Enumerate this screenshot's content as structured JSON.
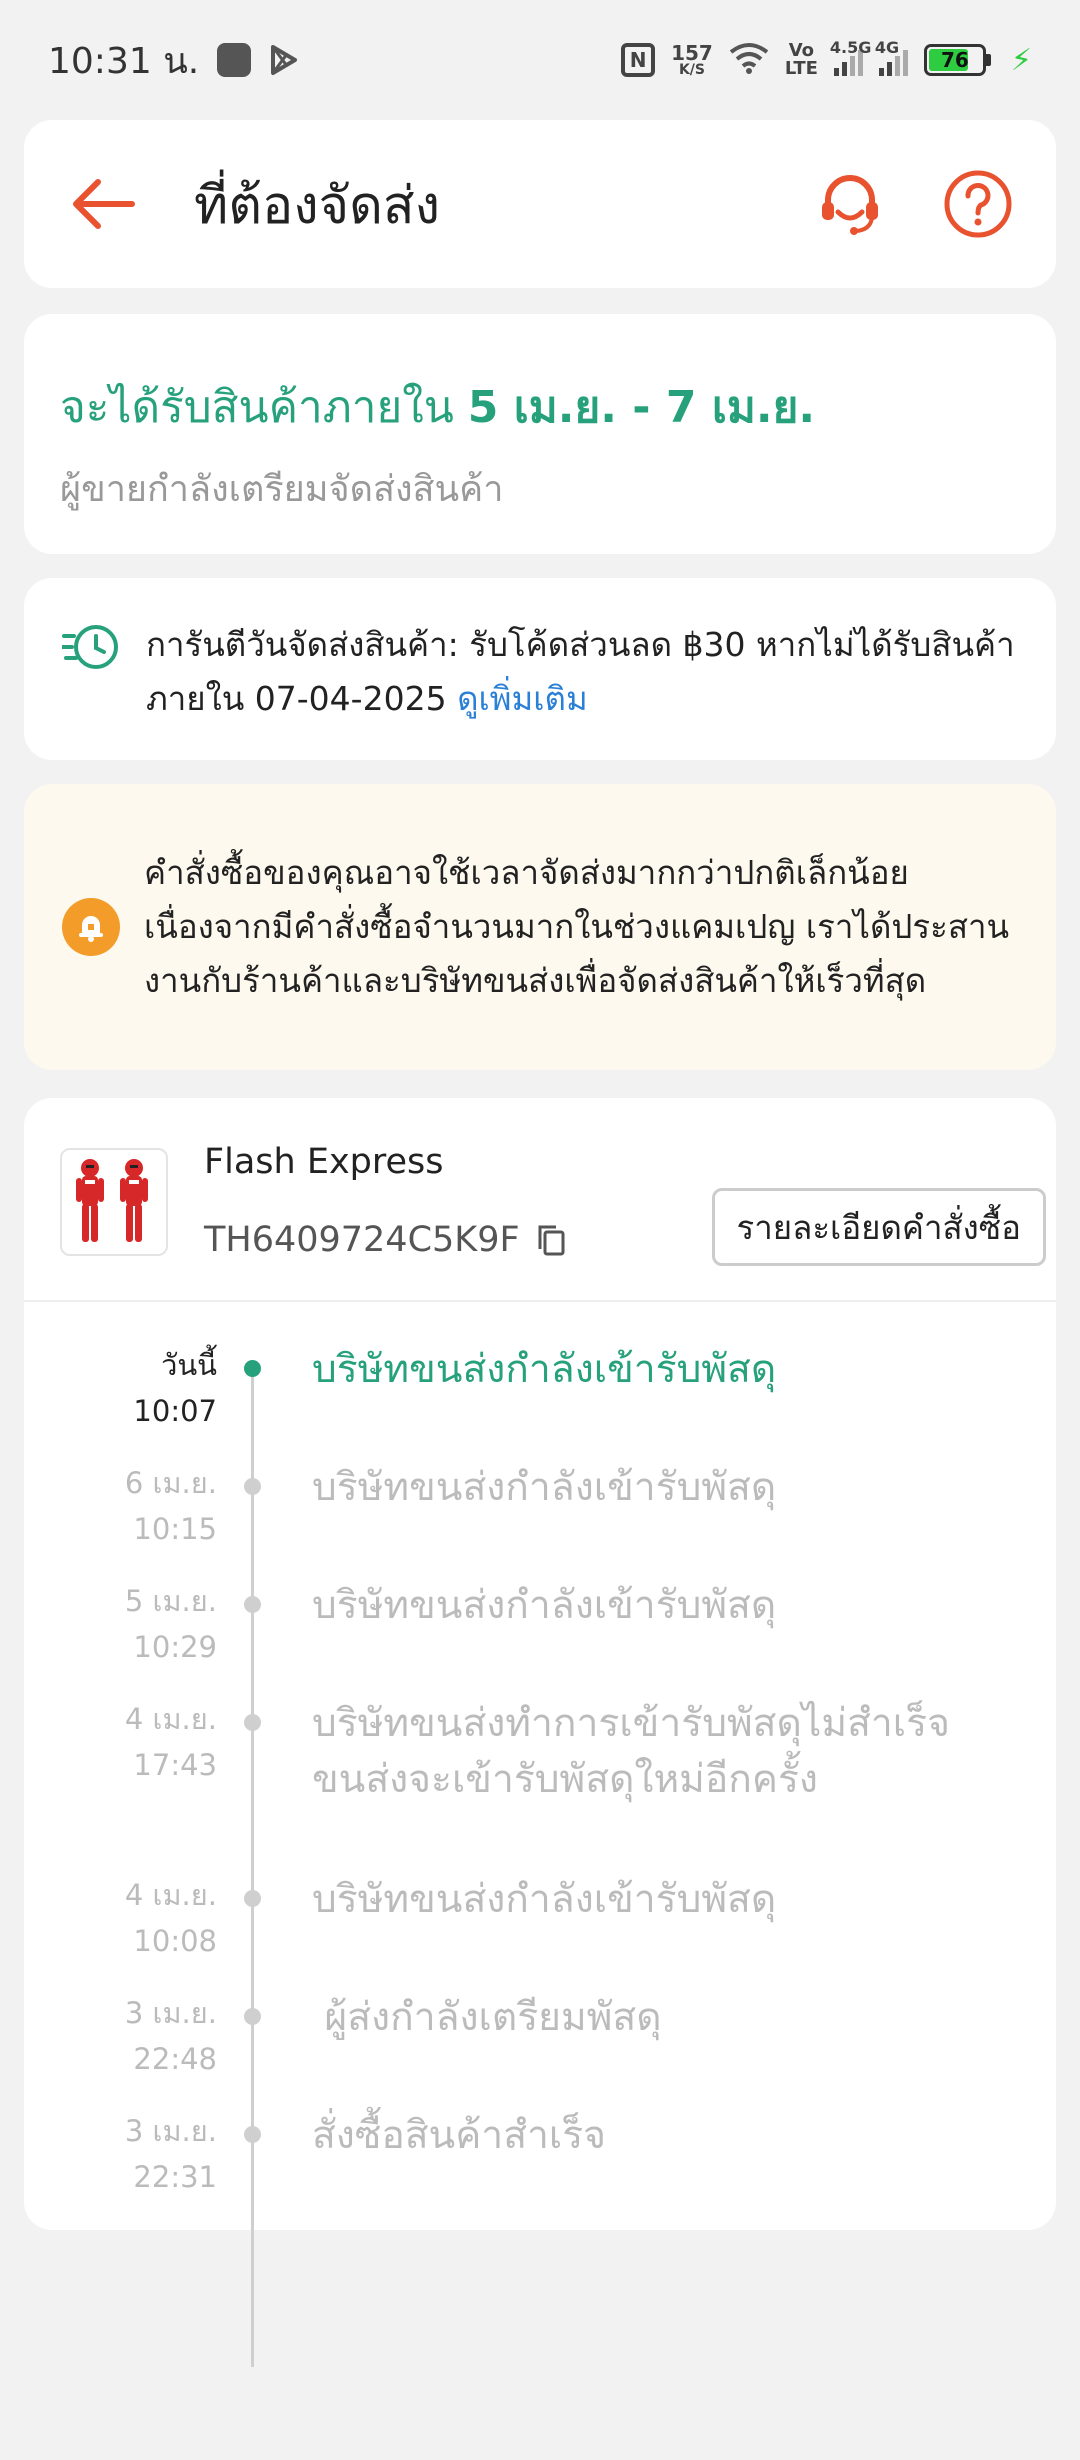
{
  "status_bar": {
    "time": "10:31 น.",
    "net_speed": "157",
    "net_unit": "K/S",
    "volte_top": "Vo",
    "volte_bottom": "LTE",
    "sig1_label": "4.5G",
    "sig2_label": "4G",
    "battery": "76",
    "battery_level": 0.76,
    "icons": [
      "square-notification-icon",
      "play-store-icon",
      "nfc-icon",
      "wifi-icon",
      "signal-icon",
      "battery-icon",
      "charging-icon"
    ]
  },
  "header": {
    "title": "ที่ต้องจัดส่ง",
    "icons": [
      "back-arrow-icon",
      "customer-support-icon",
      "help-icon"
    ],
    "accent_color": "#e8522f"
  },
  "estimate": {
    "prefix": "จะได้รับสินค้าภายใน ",
    "range": "5 เม.ย. - 7 เม.ย.",
    "subtitle": "ผู้ขายกำลังเตรียมจัดส่งสินค้า",
    "color": "#26a17b"
  },
  "guarantee": {
    "text": "การันตีวันจัดส่งสินค้า: รับโค้ดส่วนลด ฿30 หากไม่ได้รับสินค้าภายใน 07-04-2025 ",
    "link": "ดูเพิ่มเติม",
    "icon": "fast-delivery-clock-icon"
  },
  "notice": {
    "text": "คำสั่งซื้อของคุณอาจใช้เวลาจัดส่งมากกว่าปกติเล็กน้อย เนื่องจากมีคำสั่งซื้อจำนวนมากในช่วงแคมเปญ เราได้ประสานงานกับร้านค้าและบริษัทขนส่งเพื่อจัดส่งสินค้าให้เร็วที่สุด",
    "icon": "bell-icon"
  },
  "shipment": {
    "courier": "Flash Express",
    "tracking_number": "TH6409724C5K9F",
    "order_details_button": "รายละเอียดคำสั่งซื้อ",
    "events": [
      {
        "date": "วันนี้",
        "time": "10:07",
        "text": "บริษัทขนส่งกำลังเข้ารับพัสดุ",
        "active": true
      },
      {
        "date": "6 เม.ย.",
        "time": "10:15",
        "text": "บริษัทขนส่งกำลังเข้ารับพัสดุ",
        "active": false
      },
      {
        "date": "5 เม.ย.",
        "time": "10:29",
        "text": "บริษัทขนส่งกำลังเข้ารับพัสดุ",
        "active": false
      },
      {
        "date": "4 เม.ย.",
        "time": "17:43",
        "text": "บริษัทขนส่งทำการเข้ารับพัสดุไม่สำเร็จ",
        "text2": "ขนส่งจะเข้ารับพัสดุใหม่อีกครั้ง",
        "active": false
      },
      {
        "date": "4 เม.ย.",
        "time": "10:08",
        "text": "บริษัทขนส่งกำลังเข้ารับพัสดุ",
        "active": false
      },
      {
        "date": "3 เม.ย.",
        "time": "22:48",
        "text": " ผู้ส่งกำลังเตรียมพัสดุ",
        "active": false
      },
      {
        "date": "3 เม.ย.",
        "time": "22:31",
        "text": "สั่งซื้อสินค้าสำเร็จ",
        "active": false
      }
    ]
  }
}
